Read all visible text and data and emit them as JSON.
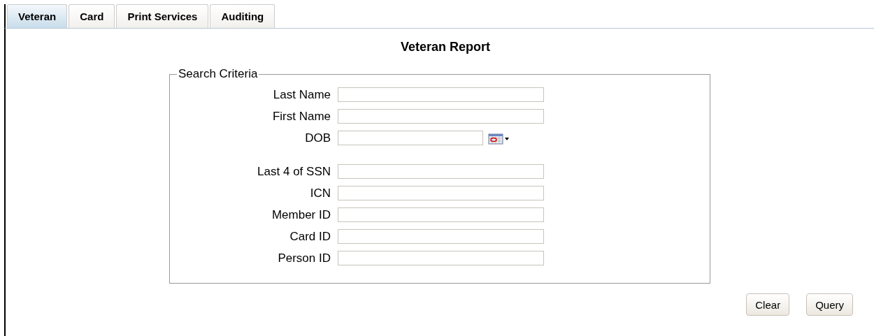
{
  "tabs": [
    {
      "label": "Veteran",
      "selected": true
    },
    {
      "label": "Card",
      "selected": false
    },
    {
      "label": "Print Services",
      "selected": false
    },
    {
      "label": "Auditing",
      "selected": false
    }
  ],
  "title": "Veteran Report",
  "search_criteria": {
    "legend": "Search Criteria",
    "fields": [
      {
        "label": "Last Name",
        "kind": "text"
      },
      {
        "label": "First Name",
        "kind": "text"
      },
      {
        "label": "DOB",
        "kind": "date"
      },
      {
        "label": "Last 4 of SSN",
        "kind": "text"
      },
      {
        "label": "ICN",
        "kind": "text"
      },
      {
        "label": "Member ID",
        "kind": "text"
      },
      {
        "label": "Card ID",
        "kind": "text"
      },
      {
        "label": "Person ID",
        "kind": "text"
      }
    ]
  },
  "buttons": [
    "Clear",
    "Query"
  ]
}
